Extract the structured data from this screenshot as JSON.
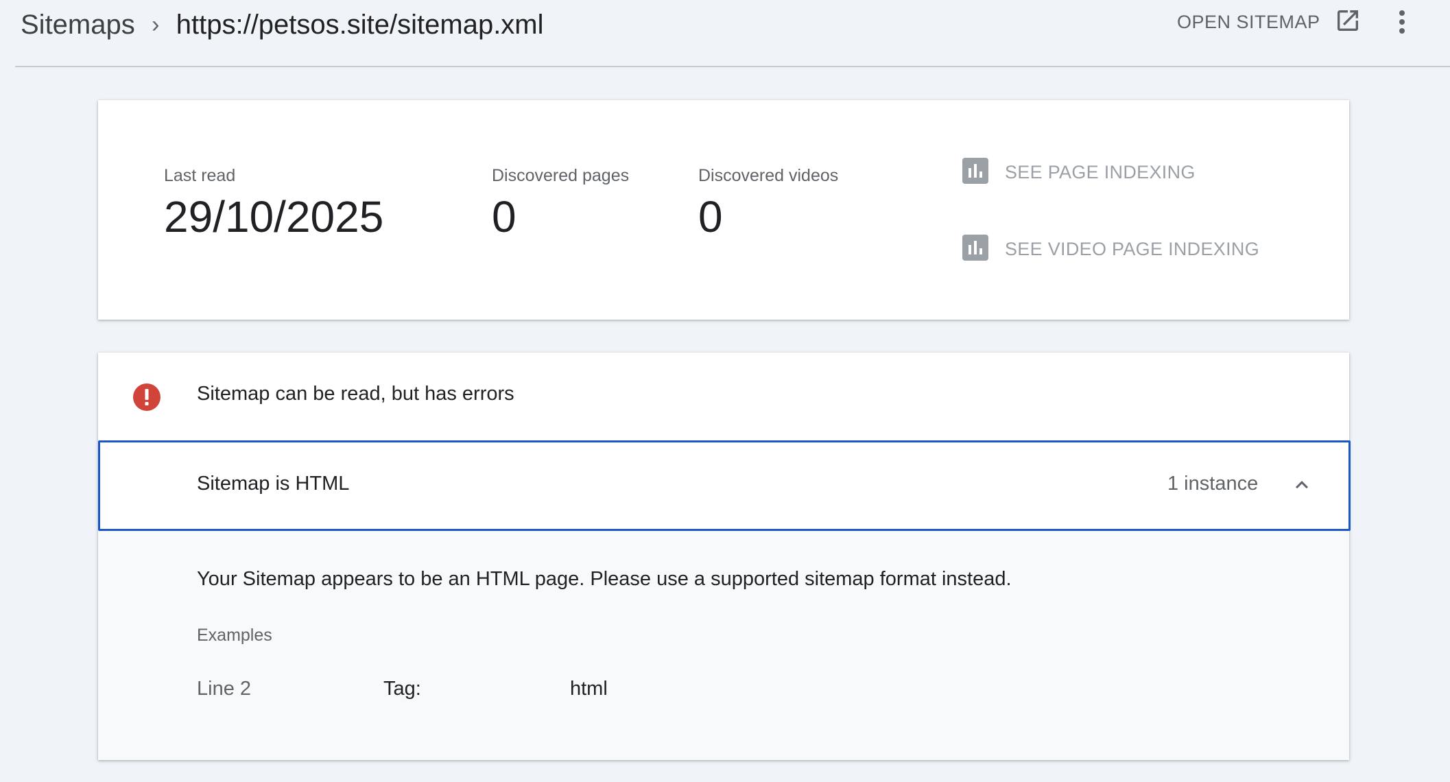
{
  "header": {
    "breadcrumb_root": "Sitemaps",
    "breadcrumb_separator": "›",
    "breadcrumb_current": "https://petsos.site/sitemap.xml",
    "open_sitemap_label": "OPEN SITEMAP",
    "open_icon": "open-in-new-icon",
    "menu_icon": "more-vert-icon"
  },
  "stats": {
    "last_read": {
      "label": "Last read",
      "value": "29/10/2025"
    },
    "discovered_pages": {
      "label": "Discovered pages",
      "value": "0"
    },
    "discovered_videos": {
      "label": "Discovered videos",
      "value": "0"
    }
  },
  "links": {
    "page_indexing": {
      "label": "SEE PAGE INDEXING",
      "icon": "bar-chart-icon"
    },
    "video_page_indexing": {
      "label": "SEE VIDEO PAGE INDEXING",
      "icon": "bar-chart-icon"
    }
  },
  "errors": {
    "status_text": "Sitemap can be read, but has errors",
    "status_icon": "error-icon",
    "status_color": "#d0443a",
    "issue": {
      "title": "Sitemap is HTML",
      "count": "1 instance",
      "expanded": true,
      "description": "Your Sitemap appears to be an HTML page. Please use a supported sitemap format instead.",
      "examples_label": "Examples",
      "examples": [
        {
          "line": "Line 2",
          "tag_label": "Tag:",
          "value": "html"
        }
      ]
    }
  },
  "colors": {
    "page_background": "#f0f3f8",
    "focus_border": "#1a56c6",
    "muted_link": "#9aa0a6"
  }
}
